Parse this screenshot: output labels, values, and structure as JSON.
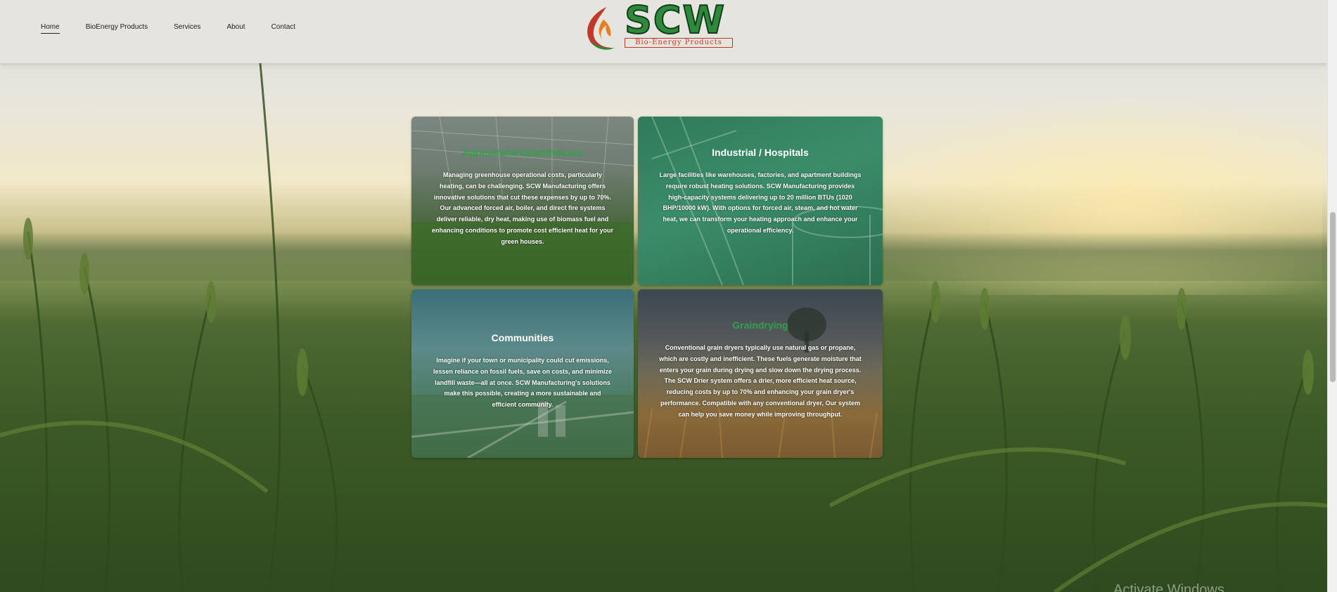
{
  "nav": {
    "items": [
      {
        "label": "Home",
        "active": true
      },
      {
        "label": "BioEnergy Products"
      },
      {
        "label": "Services"
      },
      {
        "label": "About"
      },
      {
        "label": "Contact"
      }
    ]
  },
  "logo": {
    "wordmark": "SCW",
    "tagline": "Bio-Energy Products"
  },
  "cards": {
    "greenhouse": {
      "title": "Agricultural Greenhouses",
      "text": "Managing greenhouse operational costs, particularly heating, can be challenging. SCW Manufacturing offers innovative solutions that cut these expenses by up to 70%. Our advanced forced air, boiler, and direct fire systems deliver reliable, dry heat, making use of biomass fuel and enhancing conditions to promote cost efficient heat for your green houses."
    },
    "industrial": {
      "title": "Industrial / Hospitals",
      "text": "Large facilities like warehouses, factories, and apartment buildings require robust heating solutions. SCW Manufacturing provides high-capacity systems delivering up to 20 million BTUs (1020 BHP/10000 kW). With options for forced air, steam, and hot water heat, we can transform your heating approach and enhance your operational efficiency."
    },
    "communities": {
      "title": "Communities",
      "text": "Imagine if your town or municipality could cut emissions, lessen reliance on fossil fuels, save on costs, and minimize landfill waste—all at once. SCW Manufacturing's solutions make this possible, creating a more sustainable and efficient community."
    },
    "grain": {
      "title": "Graindrying",
      "text": "Conventional grain dryers typically use natural gas or propane, which are costly and inefficient. These fuels generate moisture that enters your grain during drying and slow down the drying process. The SCW Drier system offers a drier, more efficient heat source, reducing costs by up to 70% and enhancing your grain dryer's performance. Compatible with any conventional dryer, Our system can help you save money while improving throughput."
    }
  },
  "overlay": {
    "watermark": "Activate Windows"
  },
  "colors": {
    "accent_green": "#2fa34a",
    "header_bg": "#e6e4de",
    "logo_red": "#c0392b"
  }
}
